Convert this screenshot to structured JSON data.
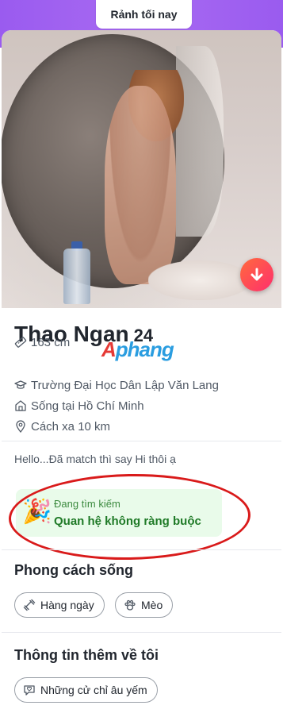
{
  "status": {
    "label": "Rảnh tối nay"
  },
  "profile": {
    "name": "Thao Ngan",
    "age": "24",
    "watermark": {
      "first": "A",
      "rest": "phang"
    },
    "info": {
      "height": "163 cm",
      "school": "Trường Đại Học Dân Lập Văn Lang",
      "lives_in": "Sống tại Hồ Chí Minh",
      "distance": "Cách xa 10 km"
    },
    "bio": "Hello...Đã match thì say Hi thôi ạ",
    "intent": {
      "emoji": "🎉",
      "label": "Đang tìm kiếm",
      "value": "Quan hệ không ràng buộc"
    }
  },
  "lifestyle": {
    "title": "Phong cách sống",
    "chips": [
      "Hàng ngày",
      "Mèo"
    ]
  },
  "more_about": {
    "title": "Thông tin thêm về tôi",
    "chips": [
      "Những cử chỉ âu yếm"
    ]
  },
  "colors": {
    "accent": "#9a5bef",
    "download_gradient_start": "#ff6a3d",
    "download_gradient_end": "#ff2f6d",
    "intent_bg": "#e9fbea",
    "intent_text": "#1f7a27",
    "annotation_circle": "#d91a1a"
  }
}
